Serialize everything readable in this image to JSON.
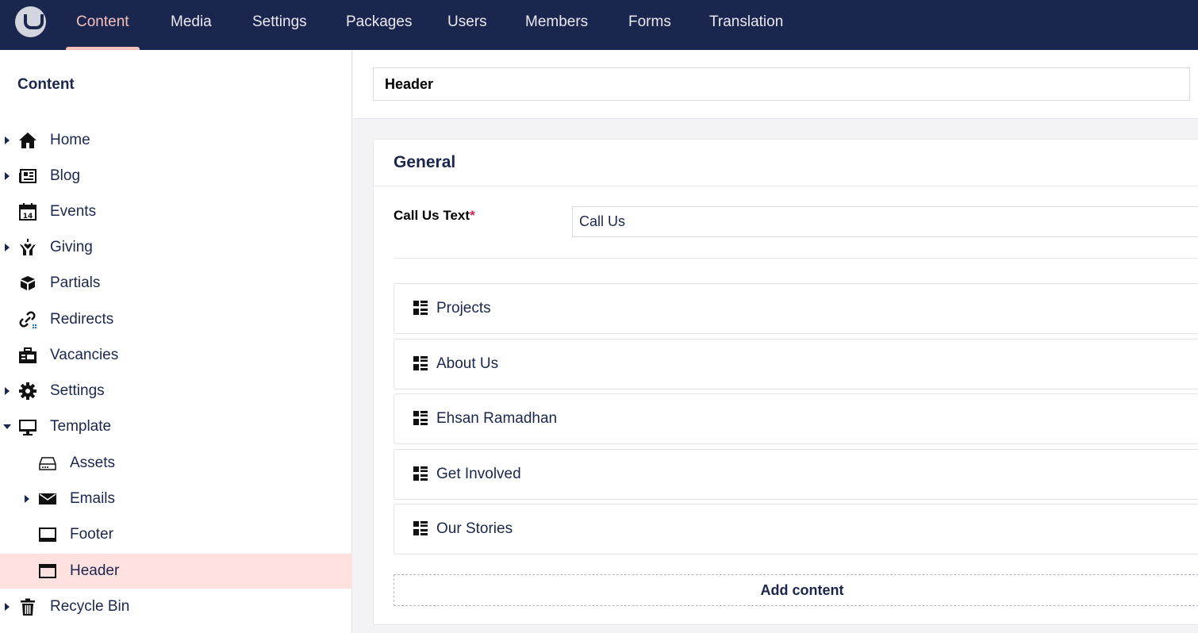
{
  "nav": {
    "items": [
      {
        "label": "Content",
        "active": true
      },
      {
        "label": "Media"
      },
      {
        "label": "Settings"
      },
      {
        "label": "Packages"
      },
      {
        "label": "Users"
      },
      {
        "label": "Members"
      },
      {
        "label": "Forms"
      },
      {
        "label": "Translation"
      }
    ]
  },
  "sidebar": {
    "title": "Content",
    "items": [
      {
        "label": "Home",
        "icon": "home-icon",
        "caret": "right"
      },
      {
        "label": "Blog",
        "icon": "newspaper-icon",
        "caret": "right"
      },
      {
        "label": "Events",
        "icon": "calendar-icon",
        "caret": "none"
      },
      {
        "label": "Giving",
        "icon": "hands-heart-icon",
        "caret": "right"
      },
      {
        "label": "Partials",
        "icon": "box-icon",
        "caret": "none"
      },
      {
        "label": "Redirects",
        "icon": "link-icon",
        "caret": "none"
      },
      {
        "label": "Vacancies",
        "icon": "briefcase-icon",
        "caret": "none"
      },
      {
        "label": "Settings",
        "icon": "gear-icon",
        "caret": "right"
      },
      {
        "label": "Template",
        "icon": "monitor-icon",
        "caret": "down"
      },
      {
        "label": "Assets",
        "icon": "drive-icon",
        "caret": "none"
      },
      {
        "label": "Emails",
        "icon": "envelope-icon",
        "caret": "right"
      },
      {
        "label": "Footer",
        "icon": "footer-layout-icon",
        "caret": "none"
      },
      {
        "label": "Header",
        "icon": "header-layout-icon",
        "caret": "none",
        "selected": true
      },
      {
        "label": "Recycle Bin",
        "icon": "trash-icon",
        "caret": "right"
      }
    ]
  },
  "editor": {
    "name_value": "Header",
    "group_title": "General",
    "call_us": {
      "label": "Call Us Text",
      "required_mark": "*",
      "value": "Call Us"
    },
    "blocks": [
      {
        "label": "Projects",
        "icon": "grid-list-icon"
      },
      {
        "label": "About Us",
        "icon": "grid-list-icon"
      },
      {
        "label": "Ehsan Ramadhan",
        "icon": "grid-list-icon"
      },
      {
        "label": "Get Involved",
        "icon": "grid-list-icon"
      },
      {
        "label": "Our Stories",
        "icon": "grid-list-icon"
      }
    ],
    "add_content_label": "Add content"
  },
  "colors": {
    "topbar": "#1b264f",
    "nav_active": "#f5c1bc",
    "selected_row": "#ffe1df",
    "text": "#1b264f",
    "required": "#d42054"
  }
}
